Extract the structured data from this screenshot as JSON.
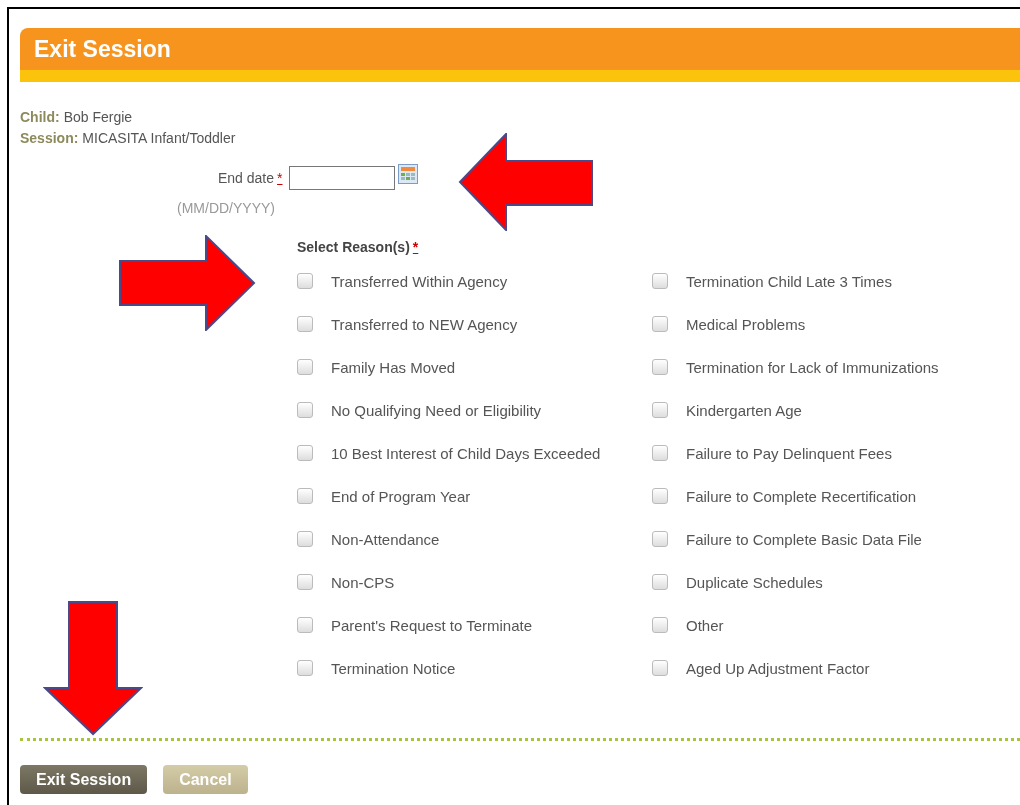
{
  "header": {
    "title": "Exit Session"
  },
  "info": [
    {
      "label": "Child:",
      "value": "Bob Fergie"
    },
    {
      "label": "Session:",
      "value": "MICASITA Infant/Toddler"
    }
  ],
  "end_date": {
    "label": "End date",
    "required": "*",
    "hint": "(MM/DD/YYYY)"
  },
  "reasons": {
    "label": "Select Reason(s)",
    "required": "*",
    "columns": [
      [
        {
          "label": "Transferred Within Agency",
          "checked": false
        },
        {
          "label": "Transferred to NEW Agency",
          "checked": false
        },
        {
          "label": "Family Has Moved",
          "checked": false
        },
        {
          "label": "No Qualifying Need or Eligibility",
          "checked": false
        },
        {
          "label": "10 Best Interest of Child Days Exceeded",
          "checked": false
        },
        {
          "label": "End of Program Year",
          "checked": false
        },
        {
          "label": "Non-Attendance",
          "checked": false
        },
        {
          "label": "Non-CPS",
          "checked": false
        },
        {
          "label": "Parent's Request to Terminate",
          "checked": false
        },
        {
          "label": "Termination Notice",
          "checked": false
        }
      ],
      [
        {
          "label": "Termination Child Late 3 Times",
          "checked": false
        },
        {
          "label": "Medical Problems",
          "checked": false
        },
        {
          "label": "Termination for Lack of Immunizations",
          "checked": false
        },
        {
          "label": "Kindergarten Age",
          "checked": false
        },
        {
          "label": "Failure to Pay Delinquent Fees",
          "checked": false
        },
        {
          "label": "Failure to Complete Recertification",
          "checked": false
        },
        {
          "label": "Failure to Complete Basic Data File",
          "checked": false
        },
        {
          "label": "Duplicate Schedules",
          "checked": false
        },
        {
          "label": "Other",
          "checked": false
        },
        {
          "label": "Aged Up Adjustment Factor",
          "checked": false
        }
      ]
    ]
  },
  "buttons": [
    {
      "label": "Exit Session",
      "kind": "primary"
    },
    {
      "label": "Cancel",
      "kind": "secondary"
    }
  ]
}
